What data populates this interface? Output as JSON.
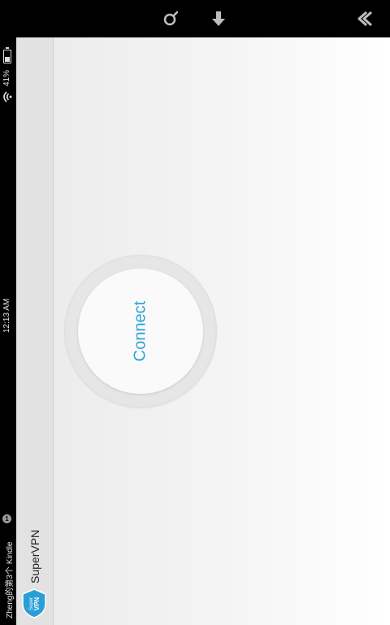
{
  "status_bar": {
    "battery_percent": "41%",
    "battery_level": 0.41,
    "time": "12:13 AM",
    "device_name": "Zheng的第3个 Kindle",
    "notification_count": "1"
  },
  "action_bar": {
    "app_title": "SuperVPN",
    "app_icon_text_top": "Super",
    "app_icon_text_bottom": "VPN"
  },
  "nav_bar": {
    "icons": [
      "search-icon",
      "download-icon",
      "back-icon"
    ]
  },
  "main": {
    "connect_label": "Connect",
    "accent_color": "#2ea3d6"
  }
}
